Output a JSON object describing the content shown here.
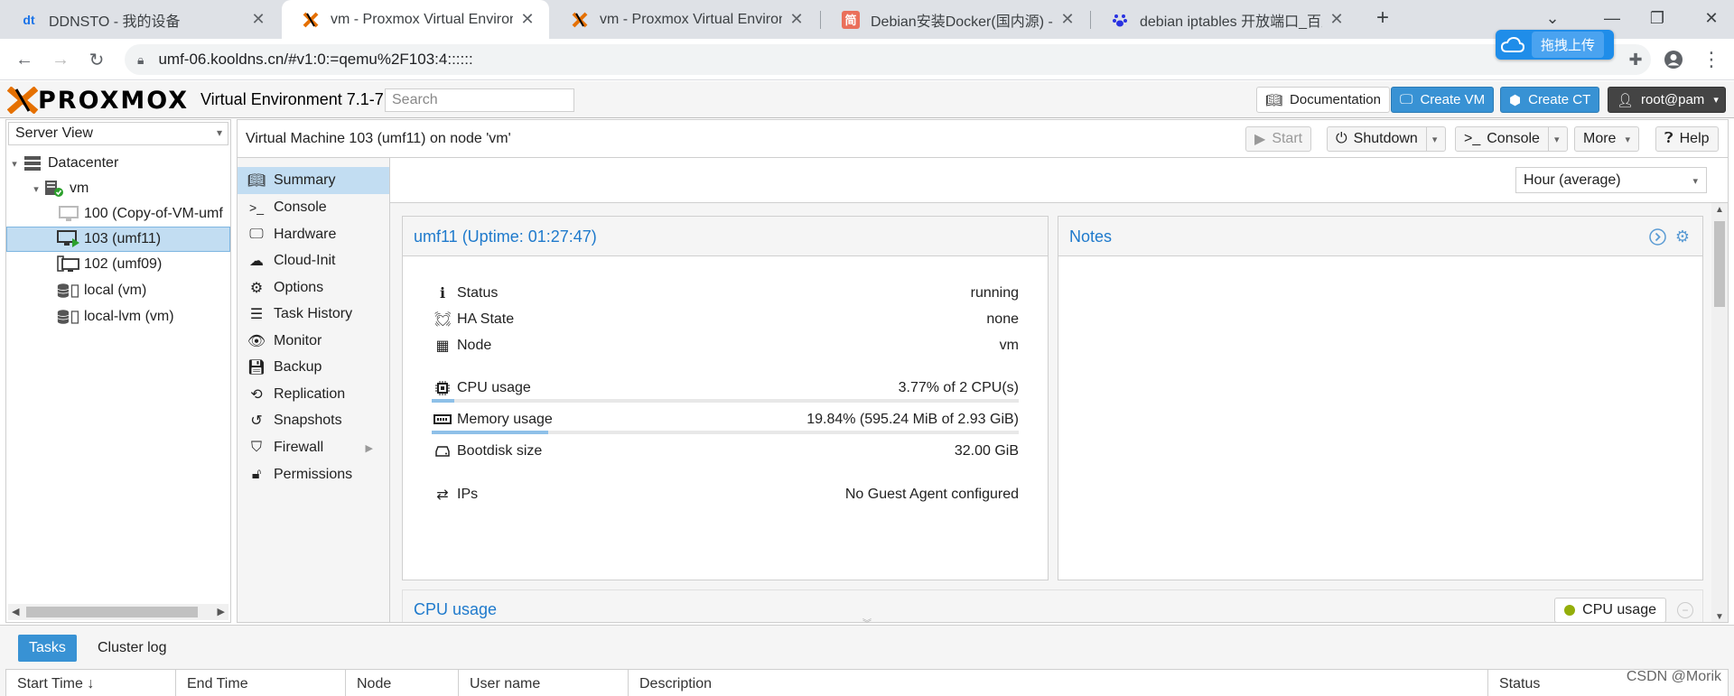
{
  "browser": {
    "tabs": [
      {
        "favicon": "dt",
        "title": "DDNSTO - 我的设备"
      },
      {
        "favicon": "proxmox-x",
        "title": "vm - Proxmox Virtual Environm"
      },
      {
        "favicon": "proxmox-x",
        "title": "vm - Proxmox Virtual Environm"
      },
      {
        "favicon": "简",
        "title": "Debian安装Docker(国内源) - 简"
      },
      {
        "favicon": "paw",
        "title": "debian iptables 开放端口_百度"
      }
    ],
    "url": "umf-06.kooldns.cn/#v1:0:=qemu%2F103:4::::::",
    "upload_label": "拖拽上传"
  },
  "header": {
    "product_version": "Virtual Environment 7.1-7",
    "search_placeholder": "Search",
    "documentation": "Documentation",
    "create_vm": "Create VM",
    "create_ct": "Create CT",
    "user": "root@pam"
  },
  "tree": {
    "view": "Server View",
    "nodes": [
      {
        "label": "Datacenter"
      },
      {
        "label": "vm"
      },
      {
        "label": "100 (Copy-of-VM-umf"
      },
      {
        "label": "103 (umf11)"
      },
      {
        "label": "102 (umf09)"
      },
      {
        "label": "local (vm)"
      },
      {
        "label": "local-lvm (vm)"
      }
    ]
  },
  "content": {
    "title": "Virtual Machine 103 (umf11) on node 'vm'",
    "toolbar": {
      "start": "Start",
      "shutdown": "Shutdown",
      "console": "Console",
      "more": "More",
      "help": "Help"
    }
  },
  "nav": {
    "items": [
      {
        "label": "Summary"
      },
      {
        "label": "Console"
      },
      {
        "label": "Hardware"
      },
      {
        "label": "Cloud-Init"
      },
      {
        "label": "Options"
      },
      {
        "label": "Task History"
      },
      {
        "label": "Monitor"
      },
      {
        "label": "Backup"
      },
      {
        "label": "Replication"
      },
      {
        "label": "Snapshots"
      },
      {
        "label": "Firewall"
      },
      {
        "label": "Permissions"
      }
    ]
  },
  "summary": {
    "timeframe": "Hour (average)",
    "status_title": "umf11 (Uptime: 01:27:47)",
    "notes_title": "Notes",
    "rows": {
      "status": {
        "label": "Status",
        "value": "running"
      },
      "ha": {
        "label": "HA State",
        "value": "none"
      },
      "node": {
        "label": "Node",
        "value": "vm"
      },
      "cpu": {
        "label": "CPU usage",
        "value": "3.77% of 2 CPU(s)",
        "fraction": 0.0377
      },
      "memory": {
        "label": "Memory usage",
        "value": "19.84% (595.24 MiB of 2.93 GiB)",
        "fraction": 0.1984
      },
      "bootdisk": {
        "label": "Bootdisk size",
        "value": "32.00 GiB"
      },
      "ips": {
        "label": "IPs",
        "value": "No Guest Agent configured"
      }
    },
    "cpu_chart_title": "CPU usage",
    "cpu_legend": "CPU usage",
    "colors": {
      "accent": "#3892d4",
      "bar": "#8ec0e8",
      "legend_dot": "#94ae0a",
      "running": "#2ca02c"
    }
  },
  "bottom": {
    "tabs": [
      {
        "label": "Tasks"
      },
      {
        "label": "Cluster log"
      }
    ],
    "columns": [
      "Start Time ↓",
      "End Time",
      "Node",
      "User name",
      "Description",
      "Status"
    ],
    "watermark": "CSDN @Morik"
  }
}
